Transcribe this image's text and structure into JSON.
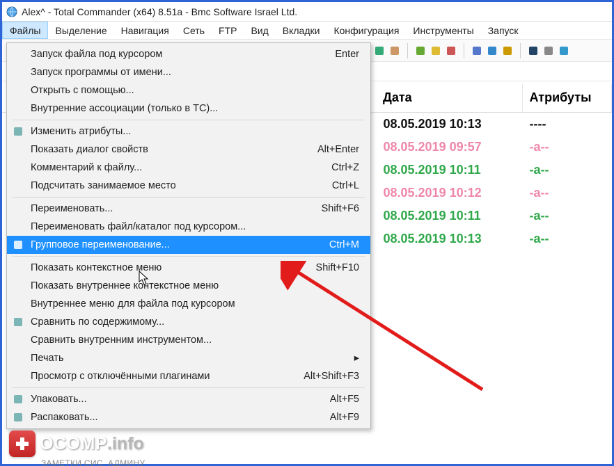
{
  "title": "Alex^ - Total Commander (x64) 8.51a - Bmc Software Israel Ltd.",
  "menubar": [
    "Файлы",
    "Выделение",
    "Навигация",
    "Сеть",
    "FTP",
    "Вид",
    "Вкладки",
    "Конфигурация",
    "Инструменты",
    "Запуск"
  ],
  "menubar_active_index": 0,
  "dropdown": {
    "groups": [
      [
        {
          "label": "Запуск файла под курсором",
          "shortcut": "Enter"
        },
        {
          "label": "Запуск программы от имени...",
          "shortcut": ""
        },
        {
          "label": "Открыть с помощью...",
          "shortcut": ""
        },
        {
          "label": "Внутренние ассоциации (только в TC)...",
          "shortcut": ""
        }
      ],
      [
        {
          "label": "Изменить атрибуты...",
          "shortcut": "",
          "icon": "attributes-icon"
        },
        {
          "label": "Показать диалог свойств",
          "shortcut": "Alt+Enter"
        },
        {
          "label": "Комментарий к файлу...",
          "shortcut": "Ctrl+Z"
        },
        {
          "label": "Подсчитать занимаемое место",
          "shortcut": "Ctrl+L"
        }
      ],
      [
        {
          "label": "Переименовать...",
          "shortcut": "Shift+F6"
        },
        {
          "label": "Переименовать файл/каталог под курсором...",
          "shortcut": ""
        },
        {
          "label": "Групповое переименование...",
          "shortcut": "Ctrl+M",
          "highlight": true,
          "icon": "rename-icon"
        }
      ],
      [
        {
          "label": "Показать контекстное меню",
          "shortcut": "Shift+F10"
        },
        {
          "label": "Показать внутреннее контекстное меню",
          "shortcut": ""
        },
        {
          "label": "Внутреннее меню для файла под курсором",
          "shortcut": ""
        },
        {
          "label": "Сравнить по содержимому...",
          "shortcut": "",
          "icon": "compare-icon"
        },
        {
          "label": "Сравнить внутренним инструментом...",
          "shortcut": ""
        },
        {
          "label": "Печать",
          "shortcut": "",
          "submenu": true
        },
        {
          "label": "Просмотр с отключёнными плагинами",
          "shortcut": "Alt+Shift+F3"
        }
      ],
      [
        {
          "label": "Упаковать...",
          "shortcut": "Alt+F5",
          "icon": "pack-icon"
        },
        {
          "label": "Распаковать...",
          "shortcut": "Alt+F9",
          "icon": "unpack-icon"
        }
      ]
    ]
  },
  "file_table": {
    "columns": [
      "Дата",
      "Атрибуты"
    ],
    "rows": [
      {
        "date": "08.05.2019 10:13",
        "attr": "----",
        "style": "black"
      },
      {
        "date": "08.05.2019 09:57",
        "attr": "-a--",
        "style": "pink"
      },
      {
        "date": "08.05.2019 10:11",
        "attr": "-a--",
        "style": "green"
      },
      {
        "date": "08.05.2019 10:12",
        "attr": "-a--",
        "style": "pink"
      },
      {
        "date": "08.05.2019 10:11",
        "attr": "-a--",
        "style": "green"
      },
      {
        "date": "08.05.2019 10:13",
        "attr": "-a--",
        "style": "green"
      }
    ]
  },
  "toolbar_icons": [
    "refresh-icon",
    "clipboard-icon",
    "paste-icon",
    "notepad-icon",
    "brush-icon",
    "grid-icon",
    "calendar-icon",
    "folder-tree-icon",
    "book-icon",
    "gears-icon",
    "globe-icon"
  ],
  "watermark": {
    "text1": "OCOMP",
    "text2": ".info",
    "sub": "ЗАМЕТКИ СИС. АДМИНУ"
  }
}
